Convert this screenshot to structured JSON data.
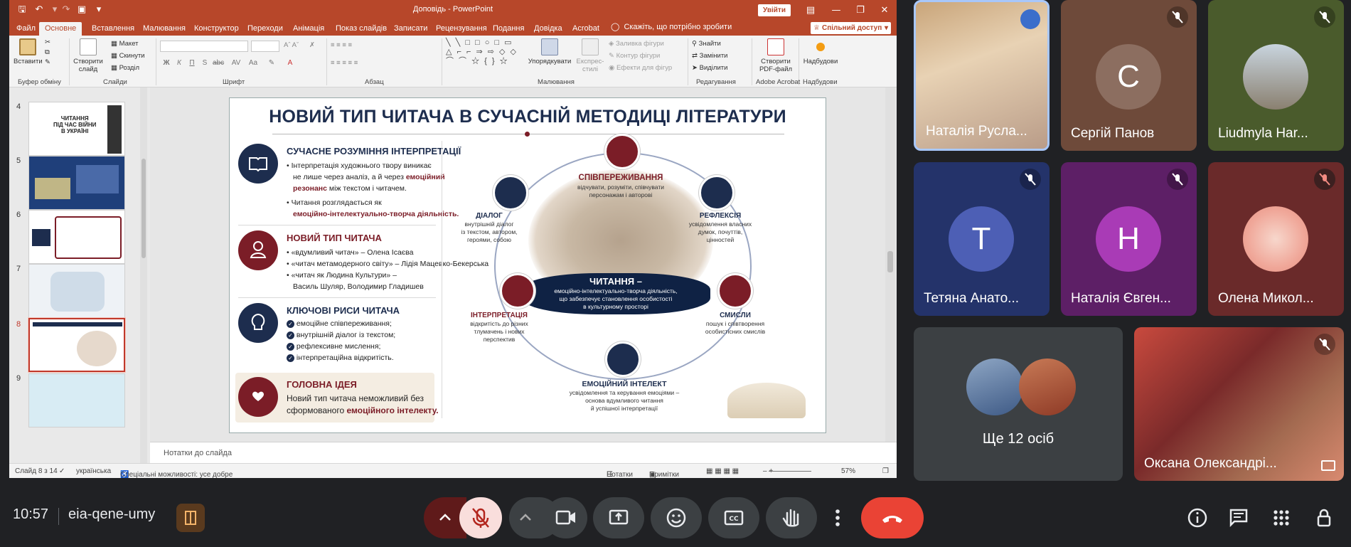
{
  "app": {
    "title": "Доповідь  -  PowerPoint",
    "signin": "Увійти",
    "share": "Спільний доступ",
    "tell_me": "Скажіть, що потрібно зробити"
  },
  "ribbon": {
    "tabs": [
      "Файл",
      "Основне",
      "Вставлення",
      "Малювання",
      "Конструктор",
      "Переходи",
      "Анімація",
      "Показ слайдів",
      "Записати",
      "Рецензування",
      "Подання",
      "Довідка",
      "Acrobat"
    ],
    "active_tab": "Основне",
    "buttons": {
      "paste": "Вставити",
      "new_slide": "Створити\nслайд",
      "layout": "Макет",
      "reset": "Скинути",
      "section": "Розділ",
      "arrange": "Упорядкувати",
      "quick_styles": "Експрес-\nстилі",
      "shape_fill": "Заливка фігури",
      "shape_outline": "Контур фігури",
      "shape_effects": "Ефекти для фігур",
      "find": "Знайти",
      "replace": "Замінити",
      "select": "Виділити",
      "create_pdf": "Створити\nPDF-файл",
      "addins": "Надбудови"
    },
    "groups": [
      "Буфер обміну",
      "Слайди",
      "Шрифт",
      "Абзац",
      "Малювання",
      "Редагування",
      "Adobe Acrobat",
      "Надбудови"
    ]
  },
  "thumbs": {
    "numbers": [
      "4",
      "5",
      "6",
      "7",
      "8",
      "9"
    ],
    "active": "8",
    "slide4_text": "ЧИТАННЯ\nПІД ЧАС ВІЙНИ\nВ УКРАЇНІ"
  },
  "slide": {
    "title": "НОВИЙ ТИП ЧИТАЧА В СУЧАСНІЙ МЕТОДИЦІ ЛІТЕРАТУРИ",
    "s1_head": "СУЧАСНЕ РОЗУМІННЯ ІНТЕРПРЕТАЦІЇ",
    "s1_b1a": "Інтерпретація художнього твору виникає",
    "s1_b1b": "не лише через аналіз, а й через",
    "s1_b1c": "емоційний",
    "s1_b1d": "резонанс",
    "s1_b1e": "між текстом і читачем.",
    "s1_b2a": "Читання розглядається як",
    "s1_b2b": "емоційно-інтелектуально-творча діяльність.",
    "s2_head": "НОВИЙ ТИП ЧИТАЧА",
    "s2_b1": "«вдумливий читач» – Олена Ісаєва",
    "s2_b2": "«читач метамодерного світу» – Лідія Мацевко-Бекерська",
    "s2_b3a": "«читач як Людина Культури» –",
    "s2_b3b": "Василь Шуляр, Володимир Гладишев",
    "s3_head": "КЛЮЧОВІ РИСИ ЧИТАЧА",
    "s3_items": [
      "емоційне співпереживання;",
      "внутрішній діалог із текстом;",
      "рефлексивне мислення;",
      "інтерпретаційна відкритість."
    ],
    "s4_head": "ГОЛОВНА ІДЕЯ",
    "s4_a": "Новий тип читача неможливий без",
    "s4_b": "сформованого",
    "s4_c": "емоційного інтелекту.",
    "center_head": "ЧИТАННЯ –",
    "center_sub1": "емоційно-інтелектуально-творча діяльність,",
    "center_sub2": "що забезпечує становлення особистості",
    "center_sub3": "в культурному просторі",
    "w_empathy": "СПІВПЕРЕЖИВАННЯ",
    "w_empathy_sub": "відчувати, розуміти, співчувати\nперсонажам і авторові",
    "w_dialog": "ДІАЛОГ",
    "w_dialog_sub": "внутрішній діалог\nіз текстом, автором,\nгероями, собою",
    "w_reflection": "РЕФЛЕКСІЯ",
    "w_reflection_sub": "усвідомлення власних\nдумок, почуттів,\nцінностей",
    "w_interp": "ІНТЕРПРЕТАЦІЯ",
    "w_interp_sub": "відкритість до різних\nтлумачень і нових\nперспектив",
    "w_meanings": "СМИСЛИ",
    "w_meanings_sub": "пошук і співтворення\nособистісних смислів",
    "w_ei": "ЕМОЦІЙНИЙ ІНТЕЛЕКТ",
    "w_ei_sub": "усвідомлення та керування емоціями –\nоснова вдумливого читання\nй успішної інтерпретації"
  },
  "notes_placeholder": "Нотатки до слайда",
  "status": {
    "slide_of": "Слайд 8 з 14",
    "language": "українська",
    "accessibility": "Спеціальні можливості: усе добре",
    "notes": "Нотатки",
    "comments": "Примітки",
    "zoom": "57%"
  },
  "participants": [
    {
      "name": "Наталія Русла...",
      "initial": "",
      "muted": false
    },
    {
      "name": "Сергій Панов",
      "initial": "C",
      "muted": true
    },
    {
      "name": "Liudmyla Har...",
      "initial": "",
      "muted": true
    },
    {
      "name": "Тетяна Анато...",
      "initial": "T",
      "muted": true
    },
    {
      "name": "Наталія Євген...",
      "initial": "Н",
      "muted": true
    },
    {
      "name": "Олена Микол...",
      "initial": "",
      "muted": true
    },
    {
      "name": "Ще 12 осіб",
      "initial": "",
      "muted": false
    },
    {
      "name": "Оксана Олександрі...",
      "initial": "",
      "muted": true
    }
  ],
  "meeting": {
    "time": "10:57",
    "code": "eia-qene-umy"
  },
  "colors": {
    "ppt_accent": "#b7472a",
    "navy": "#1d2d4e",
    "maroon": "#7b1d27",
    "end_call": "#ea4335",
    "mic_off_bg": "#f9dedc"
  }
}
